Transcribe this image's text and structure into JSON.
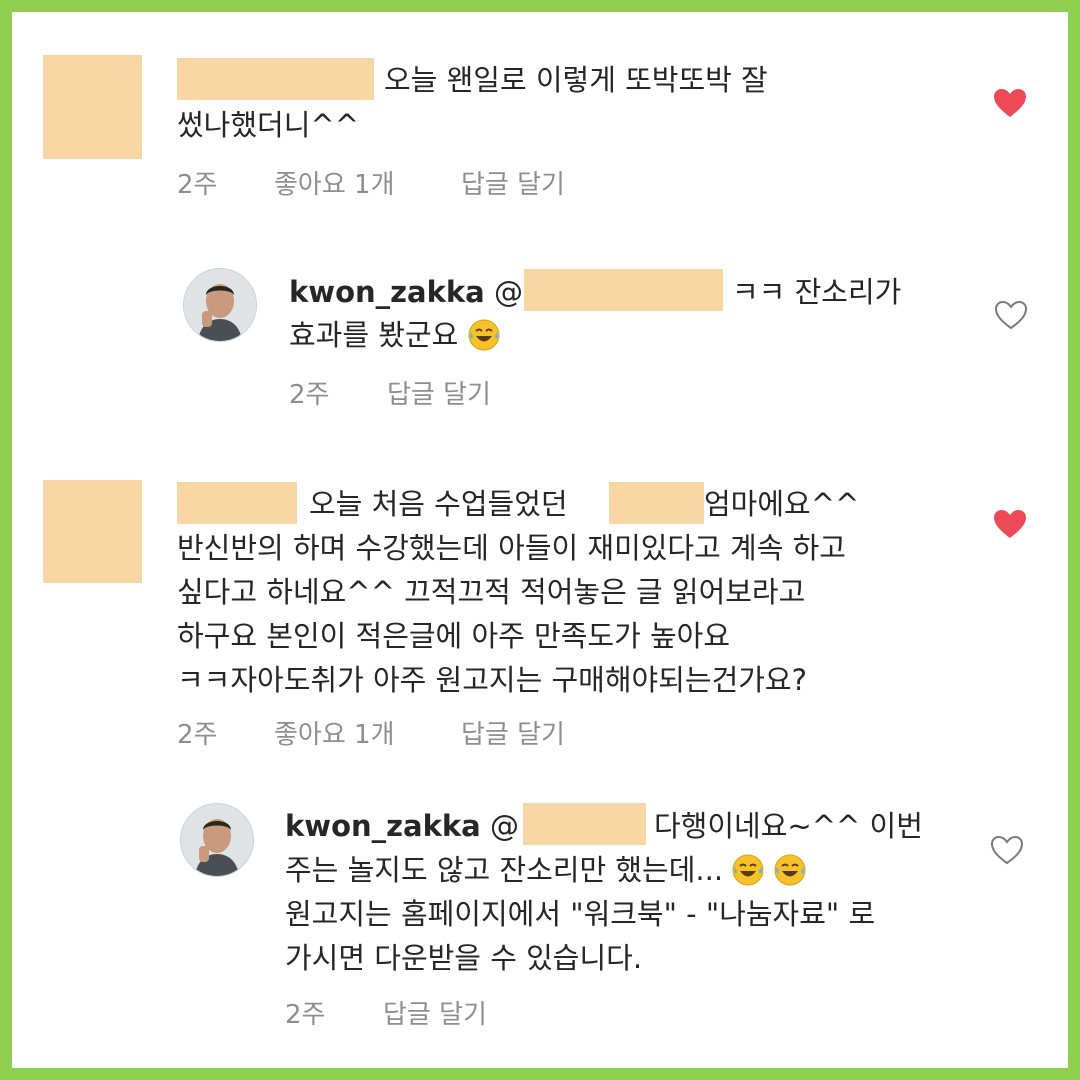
{
  "colors": {
    "border_green": "#8fcf4e",
    "redaction": "#f8d6a3",
    "liked_heart": "#ed4956",
    "meta_grey": "#8e8e8e"
  },
  "comments": [
    {
      "line1": "오늘 왠일로 이렇게 또박또박 잘",
      "line2": "썼나했더니^^",
      "time": "2주",
      "likes": "좋아요 1개",
      "reply": "답글 달기",
      "liked": true,
      "reply_item": {
        "username": "kwon_zakka",
        "mention_prefix": "@",
        "line1_tail": "ㅋㅋ 잔소리가",
        "line2": "효과를 봤군요",
        "emoji": "laughing-tears",
        "time": "2주",
        "reply": "답글 달기",
        "liked": false
      }
    },
    {
      "line1_a": "오늘 처음 수업들었던",
      "line1_b": "엄마에요^^",
      "line2": "반신반의 하며 수강했는데 아들이 재미있다고 계속 하고",
      "line3": "싶다고 하네요^^ 끄적끄적 적어놓은 글 읽어보라고",
      "line4": "하구요 본인이 적은글에 아주 만족도가 높아요",
      "line5": "ㅋㅋ자아도취가 아주 원고지는 구매해야되는건가요?",
      "time": "2주",
      "likes": "좋아요 1개",
      "reply": "답글 달기",
      "liked": true,
      "reply_item": {
        "username": "kwon_zakka",
        "mention_prefix": "@",
        "line1_tail": "다행이네요~^^ 이번",
        "line2": "주는 놀지도 않고 잔소리만 했는데...",
        "line3": "원고지는 홈페이지에서 \"워크북\" - \"나눔자료\" 로",
        "line4": "가시면 다운받을 수 있습니다.",
        "time": "2주",
        "reply": "답글 달기",
        "liked": false
      }
    }
  ]
}
